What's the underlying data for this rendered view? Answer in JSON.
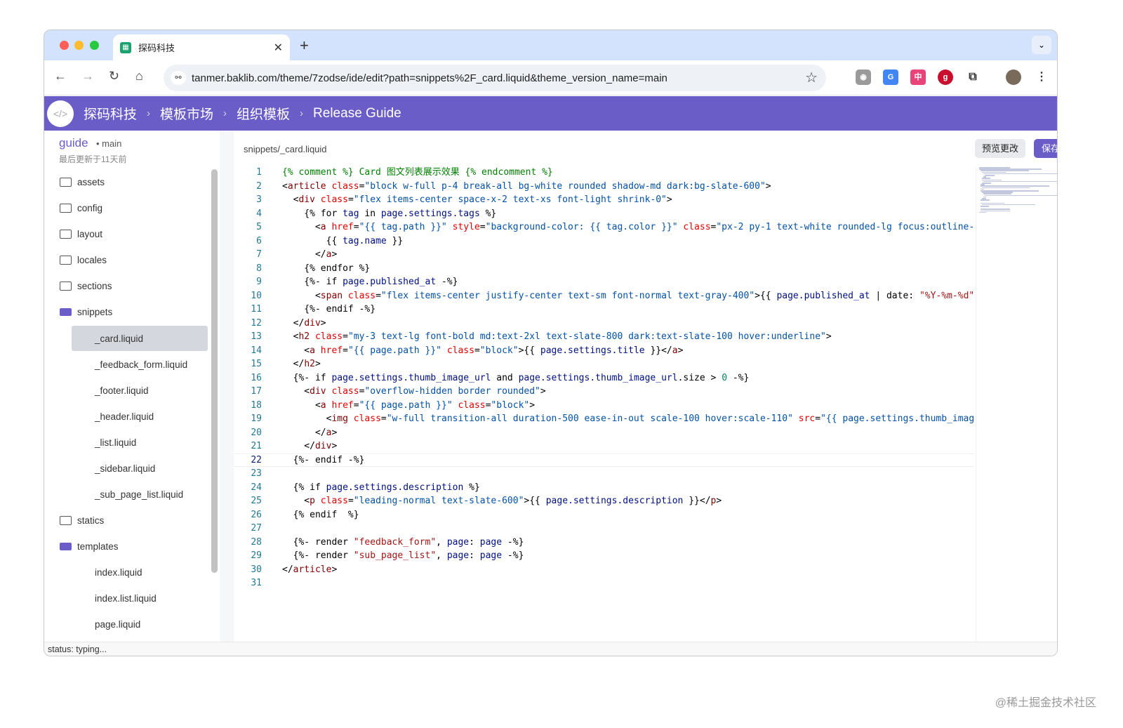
{
  "browser": {
    "tab_title": "探码科技",
    "tab_favicon": "grid-logo-icon",
    "url": "tanmer.baklib.com/theme/7zodse/ide/edit?path=snippets%2F_card.liquid&theme_version_name=main"
  },
  "header": {
    "bg_color": "#6a5dc8",
    "breadcrumb": [
      "探码科技",
      "模板市场",
      "组织模板",
      "Release Guide"
    ]
  },
  "sidebar": {
    "repo": "guide",
    "branch": "main",
    "updated": "最后更新于11天前",
    "items": [
      {
        "label": "assets",
        "type": "folder"
      },
      {
        "label": "config",
        "type": "folder"
      },
      {
        "label": "layout",
        "type": "folder"
      },
      {
        "label": "locales",
        "type": "folder"
      },
      {
        "label": "sections",
        "type": "folder"
      },
      {
        "label": "snippets",
        "type": "folder-open"
      },
      {
        "label": "_card.liquid",
        "type": "file",
        "selected": true
      },
      {
        "label": "_feedback_form.liquid",
        "type": "file"
      },
      {
        "label": "_footer.liquid",
        "type": "file"
      },
      {
        "label": "_header.liquid",
        "type": "file"
      },
      {
        "label": "_list.liquid",
        "type": "file"
      },
      {
        "label": "_sidebar.liquid",
        "type": "file"
      },
      {
        "label": "_sub_page_list.liquid",
        "type": "file"
      },
      {
        "label": "statics",
        "type": "folder"
      },
      {
        "label": "templates",
        "type": "folder-open"
      },
      {
        "label": "index.liquid",
        "type": "file"
      },
      {
        "label": "index.list.liquid",
        "type": "file"
      },
      {
        "label": "page.liquid",
        "type": "file"
      }
    ]
  },
  "editor": {
    "file_path": "snippets/_card.liquid",
    "preview_label": "预览更改",
    "save_label": "保存",
    "active_line": 22,
    "lines": [
      [
        [
          "c",
          "{% comment %} Card 图文列表展示效果 {% endcomment %}"
        ]
      ],
      [
        [
          "p",
          "<"
        ],
        [
          "t",
          "article"
        ],
        [
          "a",
          " class"
        ],
        [
          "p",
          "="
        ],
        [
          "s",
          "\"block w-full p-4 break-all bg-white rounded shadow-md dark:bg-slate-600\""
        ],
        [
          "p",
          ">"
        ]
      ],
      [
        [
          "p",
          "  <"
        ],
        [
          "t",
          "div"
        ],
        [
          "a",
          " class"
        ],
        [
          "p",
          "="
        ],
        [
          "s",
          "\"flex items-center space-x-2 text-xs font-light shrink-0\""
        ],
        [
          "p",
          ">"
        ]
      ],
      [
        [
          "p",
          "    {% for "
        ],
        [
          "v",
          "tag"
        ],
        [
          "p",
          " in "
        ],
        [
          "v",
          "page.settings.tags"
        ],
        [
          "p",
          " %}"
        ]
      ],
      [
        [
          "p",
          "      <"
        ],
        [
          "t",
          "a"
        ],
        [
          "a",
          " href"
        ],
        [
          "p",
          "="
        ],
        [
          "s",
          "\"{{ tag.path }}\""
        ],
        [
          "a",
          " style"
        ],
        [
          "p",
          "="
        ],
        [
          "s",
          "\"background-color: {{ tag.color }}\""
        ],
        [
          "a",
          " class"
        ],
        [
          "p",
          "="
        ],
        [
          "s",
          "\"px-2 py-1 text-white rounded-lg focus:outline-"
        ]
      ],
      [
        [
          "p",
          "        {{ "
        ],
        [
          "v",
          "tag.name"
        ],
        [
          "p",
          " }}"
        ]
      ],
      [
        [
          "p",
          "      </"
        ],
        [
          "t",
          "a"
        ],
        [
          "p",
          ">"
        ]
      ],
      [
        [
          "p",
          "    {% endfor %}"
        ]
      ],
      [
        [
          "p",
          "    {%- if "
        ],
        [
          "v",
          "page.published_at"
        ],
        [
          "p",
          " -%}"
        ]
      ],
      [
        [
          "p",
          "      <"
        ],
        [
          "t",
          "span"
        ],
        [
          "a",
          " class"
        ],
        [
          "p",
          "="
        ],
        [
          "s",
          "\"flex items-center justify-center text-sm font-normal text-gray-400\""
        ],
        [
          "p",
          ">{{ "
        ],
        [
          "v",
          "page.published_at"
        ],
        [
          "p",
          " | date: "
        ],
        [
          "r",
          "\"%Y-%m-%d\""
        ]
      ],
      [
        [
          "p",
          "    {%- endif -%}"
        ]
      ],
      [
        [
          "p",
          "  </"
        ],
        [
          "t",
          "div"
        ],
        [
          "p",
          ">"
        ]
      ],
      [
        [
          "p",
          "  <"
        ],
        [
          "t",
          "h2"
        ],
        [
          "a",
          " class"
        ],
        [
          "p",
          "="
        ],
        [
          "s",
          "\"my-3 text-lg font-bold md:text-2xl text-slate-800 dark:text-slate-100 hover:underline\""
        ],
        [
          "p",
          ">"
        ]
      ],
      [
        [
          "p",
          "    <"
        ],
        [
          "t",
          "a"
        ],
        [
          "a",
          " href"
        ],
        [
          "p",
          "="
        ],
        [
          "s",
          "\"{{ page.path }}\""
        ],
        [
          "a",
          " class"
        ],
        [
          "p",
          "="
        ],
        [
          "s",
          "\"block\""
        ],
        [
          "p",
          ">{{ "
        ],
        [
          "v",
          "page.settings.title"
        ],
        [
          "p",
          " }}</"
        ],
        [
          "t",
          "a"
        ],
        [
          "p",
          ">"
        ]
      ],
      [
        [
          "p",
          "  </"
        ],
        [
          "t",
          "h2"
        ],
        [
          "p",
          ">"
        ]
      ],
      [
        [
          "p",
          "  {%- if "
        ],
        [
          "v",
          "page.settings.thumb_image_url"
        ],
        [
          "p",
          " and "
        ],
        [
          "v",
          "page.settings.thumb_image_url"
        ],
        [
          "p",
          ".size > "
        ],
        [
          "n",
          "0"
        ],
        [
          "p",
          " -%}"
        ]
      ],
      [
        [
          "p",
          "    <"
        ],
        [
          "t",
          "div"
        ],
        [
          "a",
          " class"
        ],
        [
          "p",
          "="
        ],
        [
          "s",
          "\"overflow-hidden border rounded\""
        ],
        [
          "p",
          ">"
        ]
      ],
      [
        [
          "p",
          "      <"
        ],
        [
          "t",
          "a"
        ],
        [
          "a",
          " href"
        ],
        [
          "p",
          "="
        ],
        [
          "s",
          "\"{{ page.path }}\""
        ],
        [
          "a",
          " class"
        ],
        [
          "p",
          "="
        ],
        [
          "s",
          "\"block\""
        ],
        [
          "p",
          ">"
        ]
      ],
      [
        [
          "p",
          "        <"
        ],
        [
          "t",
          "img"
        ],
        [
          "a",
          " class"
        ],
        [
          "p",
          "="
        ],
        [
          "s",
          "\"w-full transition-all duration-500 ease-in-out scale-100 hover:scale-110\""
        ],
        [
          "a",
          " src"
        ],
        [
          "p",
          "="
        ],
        [
          "s",
          "\"{{ page.settings.thumb_imag"
        ]
      ],
      [
        [
          "p",
          "      </"
        ],
        [
          "t",
          "a"
        ],
        [
          "p",
          ">"
        ]
      ],
      [
        [
          "p",
          "    </"
        ],
        [
          "t",
          "div"
        ],
        [
          "p",
          ">"
        ]
      ],
      [
        [
          "p",
          "  {%- endif -%}"
        ]
      ],
      [],
      [
        [
          "p",
          "  {% if "
        ],
        [
          "v",
          "page.settings.description"
        ],
        [
          "p",
          " %}"
        ]
      ],
      [
        [
          "p",
          "    <"
        ],
        [
          "t",
          "p"
        ],
        [
          "a",
          " class"
        ],
        [
          "p",
          "="
        ],
        [
          "s",
          "\"leading-normal text-slate-600\""
        ],
        [
          "p",
          ">{{ "
        ],
        [
          "v",
          "page.settings.description"
        ],
        [
          "p",
          " }}</"
        ],
        [
          "t",
          "p"
        ],
        [
          "p",
          ">"
        ]
      ],
      [
        [
          "p",
          "  {% endif  %}"
        ]
      ],
      [],
      [
        [
          "p",
          "  {%- render "
        ],
        [
          "r",
          "\"feedback_form\""
        ],
        [
          "p",
          ", "
        ],
        [
          "v",
          "page"
        ],
        [
          "p",
          ": "
        ],
        [
          "v",
          "page"
        ],
        [
          "p",
          " -%}"
        ]
      ],
      [
        [
          "p",
          "  {%- render "
        ],
        [
          "r",
          "\"sub_page_list\""
        ],
        [
          "p",
          ", "
        ],
        [
          "v",
          "page"
        ],
        [
          "p",
          ": "
        ],
        [
          "v",
          "page"
        ],
        [
          "p",
          " -%}"
        ]
      ],
      [
        [
          "p",
          "</"
        ],
        [
          "t",
          "article"
        ],
        [
          "p",
          ">"
        ]
      ],
      []
    ]
  },
  "status": "status: typing...",
  "watermark": "@稀土掘金技术社区"
}
